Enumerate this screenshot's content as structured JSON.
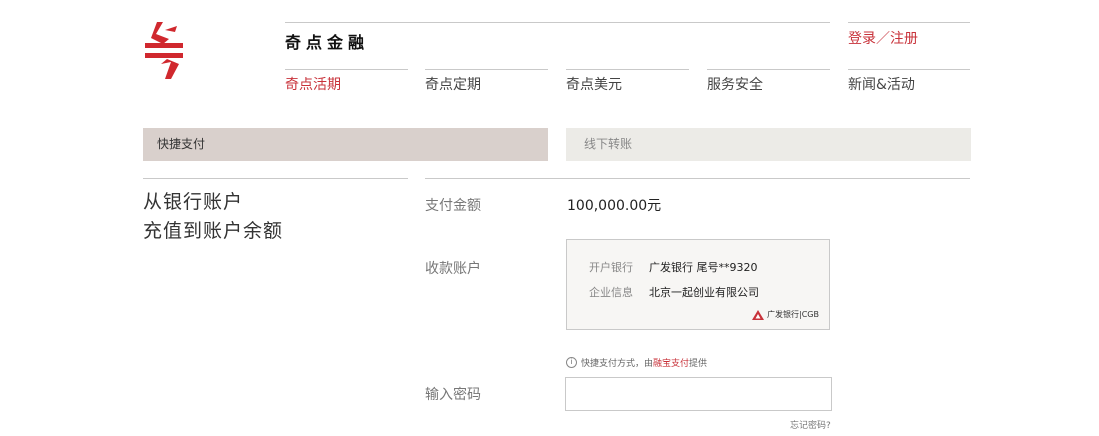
{
  "header": {
    "brand": "奇点金融",
    "login": "登录／注册",
    "nav": [
      "奇点活期",
      "奇点定期",
      "奇点美元",
      "服务安全",
      "新闻&活动"
    ]
  },
  "tabs": [
    "快捷支付",
    "线下转账"
  ],
  "headline": {
    "line1": "从银行账户",
    "line2": "充值到账户余额"
  },
  "form": {
    "amount_label": "支付金额",
    "amount_value": "100,000.00元",
    "account_label": "收款账户",
    "card": {
      "bank_label": "开户银行",
      "bank_value": "广发银行 尾号**9320",
      "company_label": "企业信息",
      "company_value": "北京一起创业有限公司",
      "bank_logo_text": "广发银行|CGB"
    },
    "note": {
      "prefix": "快捷支付方式，由",
      "highlight": "融宝支付",
      "suffix": "提供"
    },
    "password_label": "输入密码",
    "forgot": "忘记密码?"
  },
  "colors": {
    "accent": "#c8323a",
    "tab_active": "#d9d0cc",
    "tab_inactive": "#ecebe7"
  },
  "icons": {
    "logo": "qidian-logo",
    "info": "info-icon",
    "bank": "cgb-logo"
  }
}
